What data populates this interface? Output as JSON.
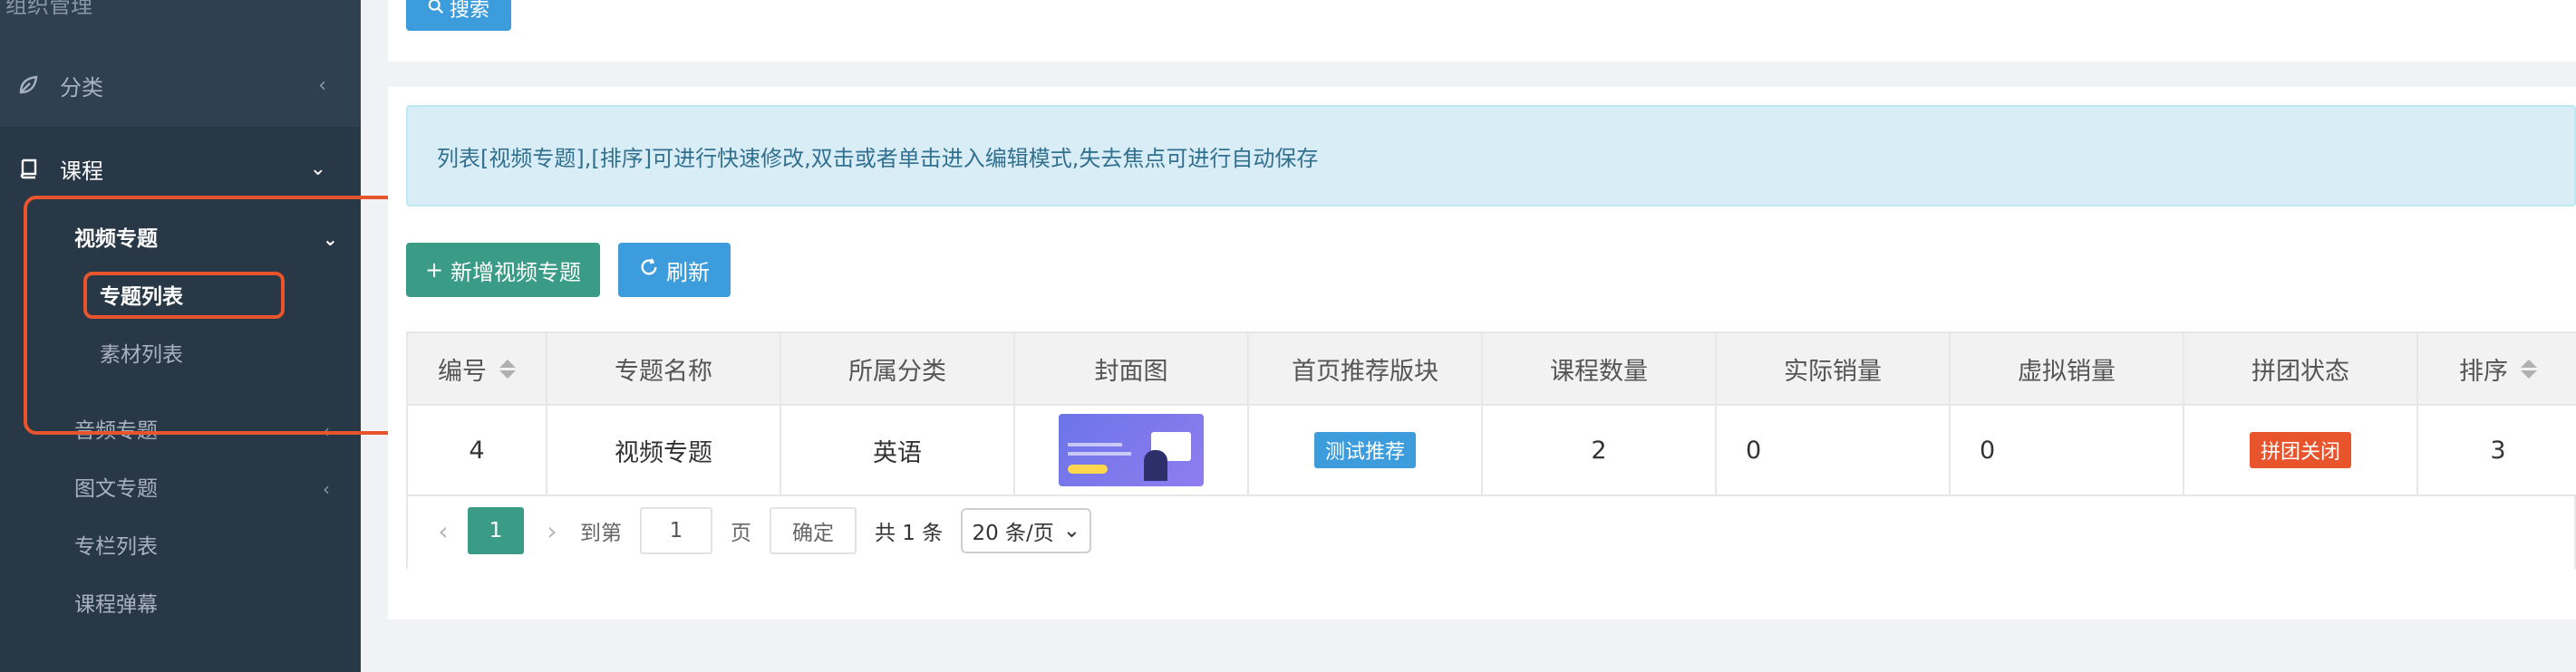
{
  "sidebar": {
    "top_fragment": "组织管理",
    "groups": [
      {
        "label": "分类",
        "icon": "leaf-icon"
      },
      {
        "label": "课程",
        "icon": "book-icon"
      }
    ],
    "items": [
      {
        "label": "视频专题",
        "expanded": true
      },
      {
        "label": "音频专题"
      },
      {
        "label": "图文专题"
      },
      {
        "label": "专栏列表"
      },
      {
        "label": "课程弹幕"
      }
    ],
    "subitems": [
      {
        "label": "专题列表",
        "active": true
      },
      {
        "label": "素材列表"
      }
    ]
  },
  "toolbar": {
    "search_label": "搜索",
    "add_label": "新增视频专题",
    "refresh_label": "刷新"
  },
  "alert": {
    "text": "列表[视频专题],[排序]可进行快速修改,双击或者单击进入编辑模式,失去焦点可进行自动保存"
  },
  "table": {
    "headers": [
      "编号",
      "专题名称",
      "所属分类",
      "封面图",
      "首页推荐版块",
      "课程数量",
      "实际销量",
      "虚拟销量",
      "拼团状态",
      "排序"
    ],
    "rows": [
      {
        "id": "4",
        "name": "视频专题",
        "category": "英语",
        "recommend": "测试推荐",
        "course_count": "2",
        "actual_sales": "0",
        "virtual_sales": "0",
        "group_status": "拼团关闭",
        "sort": "3"
      }
    ]
  },
  "pager": {
    "current": "1",
    "goto_label": "到第",
    "goto_value": "1",
    "page_label": "页",
    "confirm_label": "确定",
    "total": "共 1 条",
    "per_page": "20 条/页"
  },
  "colors": {
    "sidebar_bg": "#2f4050",
    "primary_green": "#3a9b86",
    "primary_blue": "#3c9cdc",
    "badge_blue": "#3c9cdc",
    "badge_red": "#e8552d",
    "highlight": "#e8552d"
  }
}
